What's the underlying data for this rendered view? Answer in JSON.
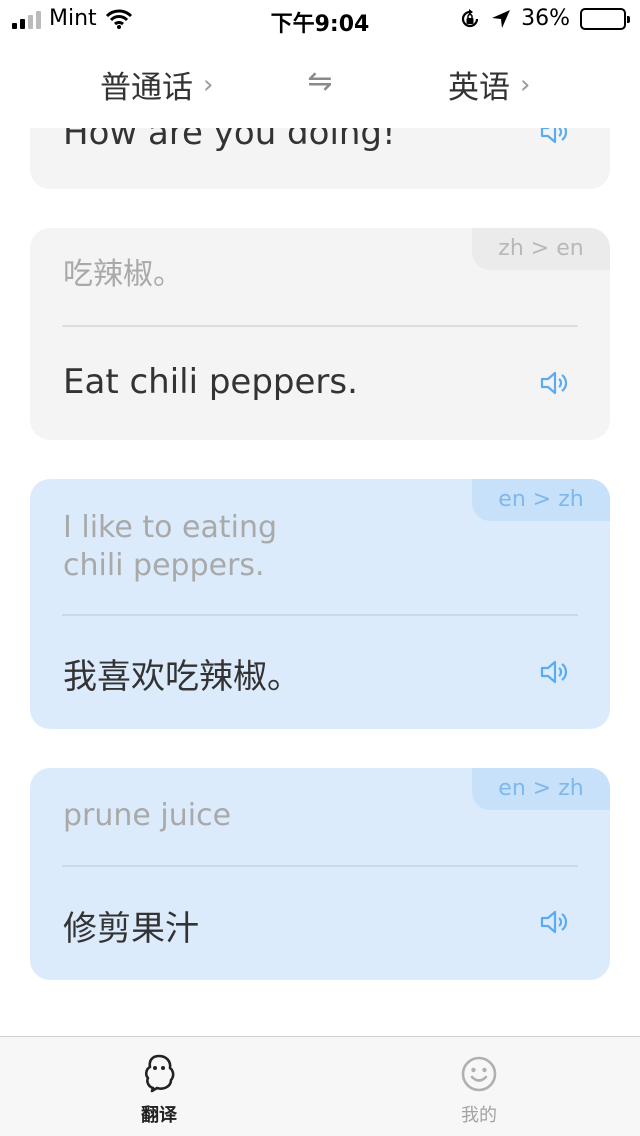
{
  "status_bar": {
    "carrier": "Mint",
    "time": "下午9:04",
    "battery": "36%"
  },
  "header": {
    "source_language": "普通话",
    "target_language": "英语"
  },
  "cards": [
    {
      "source": "",
      "translation": "How are you doing!",
      "tag": ""
    },
    {
      "source": "吃辣椒。",
      "translation": "Eat chili peppers.",
      "tag": "zh > en"
    },
    {
      "source": "I like to eating\nchili peppers.",
      "translation": "我喜欢吃辣椒。",
      "tag": "en > zh"
    },
    {
      "source": "prune juice",
      "translation": "修剪果汁",
      "tag": "en > zh"
    }
  ],
  "tabs": [
    {
      "label": "翻译",
      "icon": "translate-icon",
      "active": true
    },
    {
      "label": "我的",
      "icon": "smiley-face-icon",
      "active": false
    }
  ],
  "colors": {
    "accent": "#5aabef",
    "blue_card": "#dcebfc",
    "gray_card": "#f4f4f4"
  }
}
